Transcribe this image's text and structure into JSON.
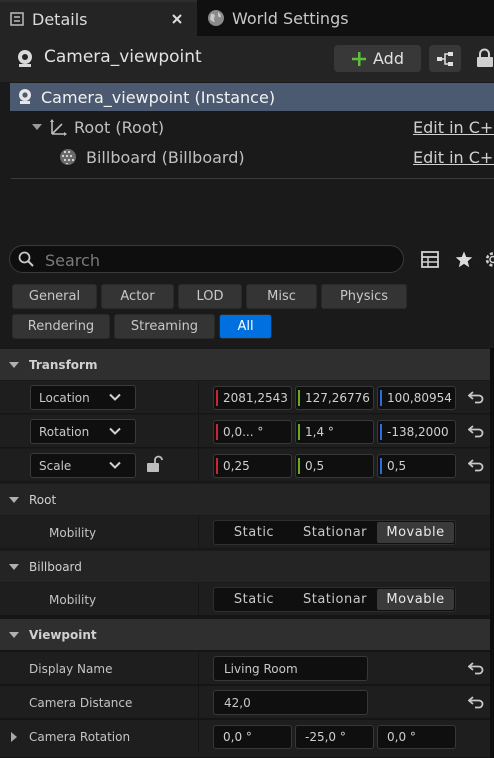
{
  "tabs": {
    "details": "Details",
    "world_settings": "World Settings"
  },
  "header": {
    "title": "Camera_viewpoint",
    "add_label": "Add"
  },
  "tree": {
    "instance": "Camera_viewpoint (Instance)",
    "root": "Root (Root)",
    "billboard": "Billboard (Billboard)",
    "edit_link": "Edit in C++"
  },
  "search": {
    "placeholder": "Search"
  },
  "filters": [
    "General",
    "Actor",
    "LOD",
    "Misc",
    "Physics",
    "Rendering",
    "Streaming",
    "All"
  ],
  "active_filter": "All",
  "transform": {
    "header": "Transform",
    "location": {
      "label": "Location",
      "x": "2081,2543",
      "y": "127,26776",
      "z": "100,80954"
    },
    "rotation": {
      "label": "Rotation",
      "x": "0,0... °",
      "y": "1,4 °",
      "z": "-138,2000"
    },
    "scale": {
      "label": "Scale",
      "x": "0,25",
      "y": "0,5",
      "z": "0,5"
    }
  },
  "root_section": {
    "header": "Root",
    "mobility_label": "Mobility",
    "options": [
      "Static",
      "Stationar",
      "Movable"
    ],
    "selected": "Movable"
  },
  "billboard_section": {
    "header": "Billboard",
    "mobility_label": "Mobility",
    "options": [
      "Static",
      "Stationar",
      "Movable"
    ],
    "selected": "Movable"
  },
  "viewpoint": {
    "header": "Viewpoint",
    "display_name_label": "Display Name",
    "display_name_value": "Living Room",
    "camera_distance_label": "Camera Distance",
    "camera_distance_value": "42,0",
    "camera_rotation_label": "Camera Rotation",
    "camera_rotation": {
      "x": "0,0 °",
      "y": "-25,0 °",
      "z": "0,0 °"
    }
  },
  "colors": {
    "accent": "#0070e0",
    "axis_x": "#c8282d",
    "axis_y": "#6aaa20",
    "axis_z": "#2c6ed8",
    "selection": "#4b5a70",
    "add_plus": "#5fbf3a"
  },
  "icons": [
    "close-icon",
    "globe-icon",
    "actor-icon",
    "add-plus-icon",
    "blueprint-icon",
    "lock-icon",
    "root-icon",
    "billboard-icon",
    "search-icon",
    "table-view-icon",
    "star-icon",
    "settings-icon",
    "chevron-down-icon",
    "reset-arrow-icon",
    "unlock-icon"
  ]
}
